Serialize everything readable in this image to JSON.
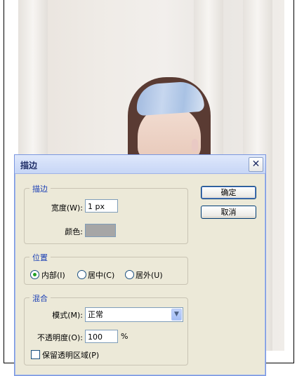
{
  "dialog": {
    "title": "描边",
    "close_glyph": "✕"
  },
  "stroke_group": {
    "legend": "描边",
    "width_label": "宽度(W):",
    "width_value": "1 px",
    "color_label": "颜色:",
    "color_value": "#a6a6a6"
  },
  "position_group": {
    "legend": "位置",
    "options": [
      {
        "label": "内部(I)",
        "selected": true
      },
      {
        "label": "居中(C)",
        "selected": false
      },
      {
        "label": "居外(U)",
        "selected": false
      }
    ]
  },
  "blend_group": {
    "legend": "混合",
    "mode_label": "模式(M):",
    "mode_value": "正常",
    "opacity_label": "不透明度(O):",
    "opacity_value": "100",
    "opacity_unit": "%",
    "preserve_label": "保留透明区域(P)",
    "preserve_checked": false
  },
  "buttons": {
    "ok": "确定",
    "cancel": "取消"
  }
}
